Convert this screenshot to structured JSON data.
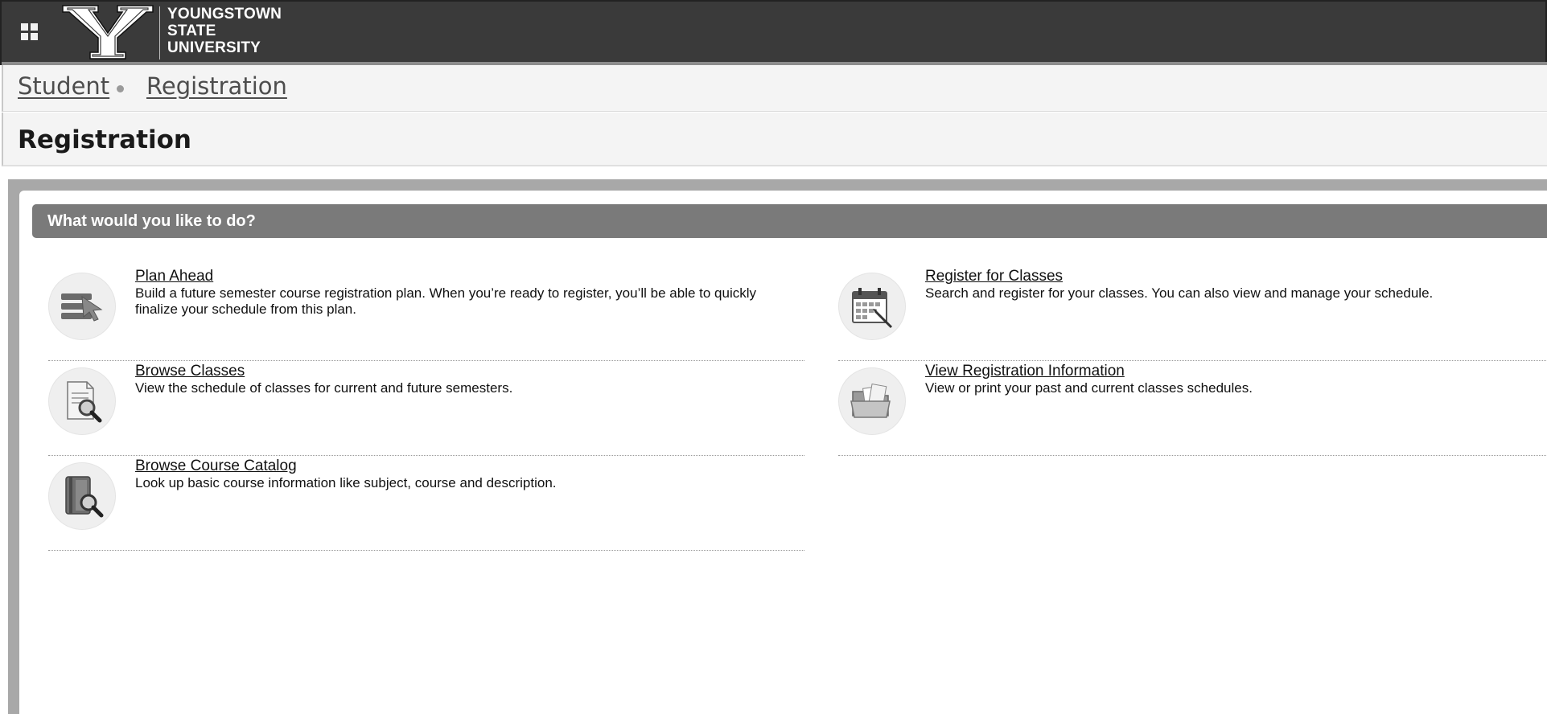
{
  "header": {
    "logo_lines": [
      "YOUNGSTOWN",
      "STATE",
      "UNIVERSITY"
    ],
    "logo_letter": "Y"
  },
  "breadcrumb": {
    "items": [
      "Student",
      "Registration"
    ]
  },
  "page": {
    "title": "Registration"
  },
  "section": {
    "header": "What would you like to do?"
  },
  "tiles": [
    {
      "title": "Plan Ahead",
      "description": "Build a future semester course registration plan. When you’re ready to register, you’ll be able to quickly finalize your schedule from this plan.",
      "icon": "plan-ahead-icon"
    },
    {
      "title": "Register for Classes",
      "description": "Search and register for your classes. You can also view and manage your schedule.",
      "icon": "calendar-icon"
    },
    {
      "title": "Browse Classes",
      "description": "View the schedule of classes for current and future semesters.",
      "icon": "document-search-icon"
    },
    {
      "title": "View Registration Information",
      "description": "View or print your past and current classes schedules.",
      "icon": "folder-icon"
    },
    {
      "title": "Browse Course Catalog",
      "description": "Look up basic course information like subject, course and description.",
      "icon": "book-search-icon"
    }
  ],
  "colors": {
    "topbar": "#3a3a3a",
    "section_header": "#7a7a7a",
    "panel_border": "#a8a8a8"
  }
}
